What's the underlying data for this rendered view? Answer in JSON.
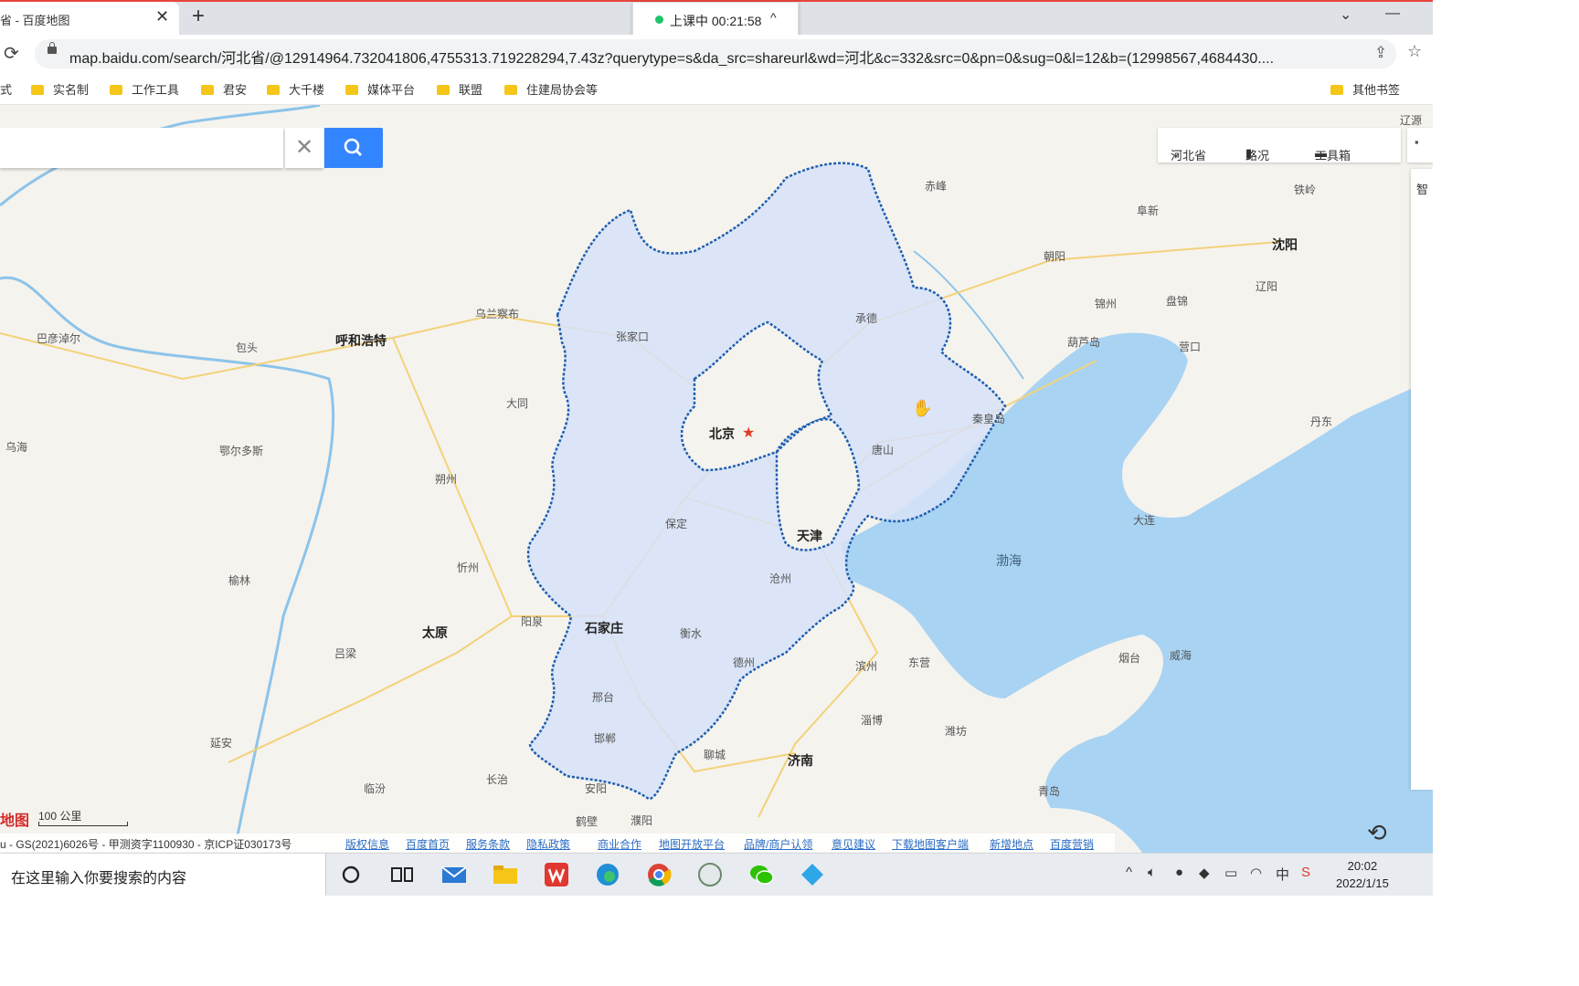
{
  "browser": {
    "tab_title": "省 - 百度地图",
    "tab_close": "✕",
    "new_tab": "+",
    "timer_text": "上课中 00:21:58",
    "timer_caret": "^",
    "window_minimize": "—",
    "window_dropdown": "⌄",
    "url": "map.baidu.com/search/河北省/@12914964.732041806,4755313.719228294,7.43z?querytype=s&da_src=shareurl&wd=河北&c=332&src=0&pn=0&sug=0&l=12&b=(12998567,4684430....",
    "bookmarks": [
      "式",
      "实名制",
      "工作工具",
      "君安",
      "大千楼",
      "媒体平台",
      "联盟",
      "住建局协会等"
    ],
    "other_bookmarks": "其他书签"
  },
  "map": {
    "search": {
      "value": "",
      "placeholder": ""
    },
    "province_select": "河北省",
    "traffic": "路况",
    "toolbox": "工具箱",
    "side_tab": "智",
    "colors": {
      "province_fill": "#d6e2f8",
      "province_border": "#1f5fb0",
      "sea": "#a9d3f2",
      "land": "#f5f3ee",
      "road": "#f3d27a",
      "river": "#8cc4ea"
    },
    "cities": [
      {
        "name": "北京",
        "big": true,
        "star": true
      },
      {
        "name": "天津",
        "big": true
      },
      {
        "name": "石家庄",
        "big": true
      },
      {
        "name": "呼和浩特",
        "big": true
      },
      {
        "name": "太原",
        "big": true
      },
      {
        "name": "济南",
        "big": true
      },
      {
        "name": "沈阳",
        "big": true
      },
      {
        "name": "张家口"
      },
      {
        "name": "承德"
      },
      {
        "name": "秦皇岛"
      },
      {
        "name": "唐山"
      },
      {
        "name": "保定"
      },
      {
        "name": "沧州"
      },
      {
        "name": "衡水"
      },
      {
        "name": "邢台"
      },
      {
        "name": "邯郸"
      },
      {
        "name": "安阳"
      },
      {
        "name": "鹤壁"
      },
      {
        "name": "濮阳"
      },
      {
        "name": "长治"
      },
      {
        "name": "临汾"
      },
      {
        "name": "阳泉"
      },
      {
        "name": "忻州"
      },
      {
        "name": "朔州"
      },
      {
        "name": "大同"
      },
      {
        "name": "乌兰察布"
      },
      {
        "name": "包头"
      },
      {
        "name": "巴彦淖尔"
      },
      {
        "name": "乌海"
      },
      {
        "name": "鄂尔多斯"
      },
      {
        "name": "榆林"
      },
      {
        "name": "吕梁"
      },
      {
        "name": "延安"
      },
      {
        "name": "赤峰"
      },
      {
        "name": "朝阳"
      },
      {
        "name": "阜新"
      },
      {
        "name": "铁岭"
      },
      {
        "name": "锦州"
      },
      {
        "name": "盘锦"
      },
      {
        "name": "辽阳"
      },
      {
        "name": "葫芦岛"
      },
      {
        "name": "营口"
      },
      {
        "name": "丹东"
      },
      {
        "name": "大连"
      },
      {
        "name": "辽源"
      },
      {
        "name": "德州"
      },
      {
        "name": "滨州"
      },
      {
        "name": "东营"
      },
      {
        "name": "淄博"
      },
      {
        "name": "潍坊"
      },
      {
        "name": "烟台"
      },
      {
        "name": "威海"
      },
      {
        "name": "聊城"
      },
      {
        "name": "青岛"
      }
    ],
    "sea_label": "渤海",
    "scale_label": "100 公里",
    "logo_text": "地图",
    "footer": {
      "copyright": "u - GS(2021)6026号 - 甲测资字1100930 - 京ICP证030173号",
      "links": [
        "版权信息",
        "百度首页",
        "服务条款",
        "隐私政策",
        "商业合作",
        "地图开放平台",
        "品牌/商户认领",
        "意见建议",
        "下载地图客户端",
        "新增地点",
        "百度营销"
      ]
    }
  },
  "taskbar": {
    "search_placeholder": "在这里输入你要搜索的内容",
    "ime": "中",
    "time": "20:02",
    "date": "2022/1/15"
  }
}
